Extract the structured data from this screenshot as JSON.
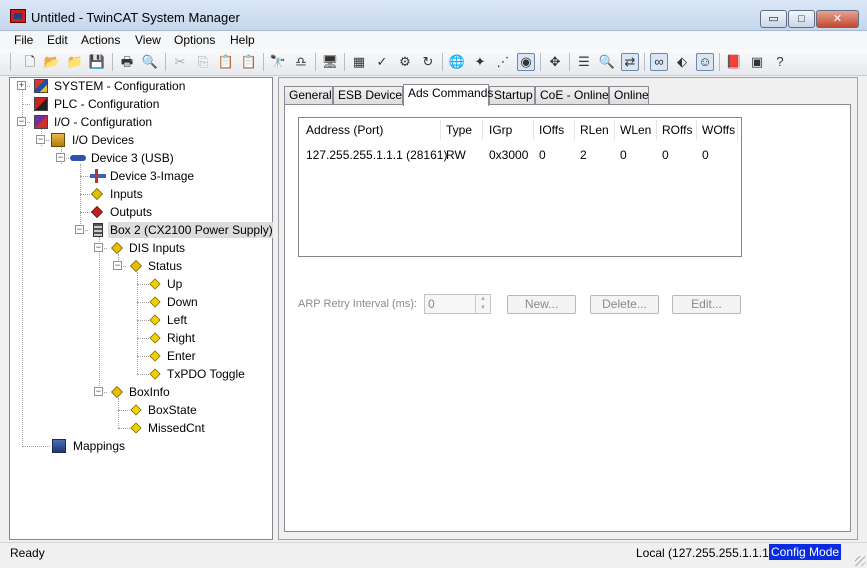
{
  "window": {
    "title": "Untitled - TwinCAT System Manager",
    "buttons": {
      "minimize": "▭",
      "maximize": "□",
      "close": "✕"
    }
  },
  "menu": [
    "File",
    "Edit",
    "Actions",
    "View",
    "Options",
    "Help"
  ],
  "toolbar": {
    "icons": [
      "new-icon",
      "open-icon",
      "open-folder-icon",
      "save-icon",
      "print-icon",
      "print-preview-icon",
      "cut-icon",
      "copy-icon",
      "paste-icon",
      "paste-with-links-icon",
      "find-icon",
      "find-next-icon",
      "target-system-icon",
      "generate-mappings-icon",
      "check-configuration-icon",
      "activate-configuration-icon",
      "restart-icon",
      "network-icon",
      "scan-icon",
      "start-free-run-icon",
      "toggle-online-icon",
      "append-icon",
      "show-variables-icon",
      "zoom-icon",
      "edit-mode-icon",
      "watch-icon",
      "connect-icon",
      "online-view-icon",
      "help-book-icon",
      "about-icon",
      "help-icon"
    ]
  },
  "tree": {
    "nodes": [
      {
        "label": "SYSTEM - Configuration",
        "icon": "system-icon"
      },
      {
        "label": "PLC - Configuration",
        "icon": "plc-icon"
      },
      {
        "label": "I/O - Configuration",
        "icon": "io-icon"
      },
      {
        "label": "I/O Devices",
        "icon": "devices-icon"
      },
      {
        "label": "Device 3 (USB)",
        "icon": "usb-device-icon"
      },
      {
        "label": "Device 3-Image",
        "icon": "process-image-icon"
      },
      {
        "label": "Inputs",
        "icon": "inputs-icon"
      },
      {
        "label": "Outputs",
        "icon": "outputs-icon"
      },
      {
        "label": "Box 2 (CX2100 Power Supply)",
        "icon": "box-icon"
      },
      {
        "label": "DIS Inputs",
        "icon": "inputs-icon"
      },
      {
        "label": "Status",
        "icon": "inputs-icon"
      },
      {
        "label": "Up",
        "icon": "variable-icon"
      },
      {
        "label": "Down",
        "icon": "variable-icon"
      },
      {
        "label": "Left",
        "icon": "variable-icon"
      },
      {
        "label": "Right",
        "icon": "variable-icon"
      },
      {
        "label": "Enter",
        "icon": "variable-icon"
      },
      {
        "label": "TxPDO Toggle",
        "icon": "variable-icon"
      },
      {
        "label": "BoxInfo",
        "icon": "inputs-icon"
      },
      {
        "label": "BoxState",
        "icon": "variable-icon"
      },
      {
        "label": "MissedCnt",
        "icon": "variable-icon"
      },
      {
        "label": "Mappings",
        "icon": "mappings-icon"
      }
    ]
  },
  "tabs": [
    "General",
    "ESB Device",
    "Ads Commands",
    "Startup",
    "CoE - Online",
    "Online"
  ],
  "active_tab": "Ads Commands",
  "ads_table": {
    "columns": [
      "Address (Port)",
      "Type",
      "IGrp",
      "IOffs",
      "RLen",
      "WLen",
      "ROffs",
      "WOffs"
    ],
    "rows": [
      [
        "127.255.255.1.1.1 (28161)",
        "RW",
        "0x3000",
        "0",
        "2",
        "0",
        "0",
        "0"
      ]
    ]
  },
  "arp": {
    "label": "ARP Retry Interval (ms):",
    "value": "0",
    "buttons": [
      "New...",
      "Delete...",
      "Edit..."
    ]
  },
  "status": {
    "left": "Ready",
    "address": "Local (127.255.255.1.1.1)",
    "mode": "Config Mode",
    "mode_color": "#0a2ce0"
  }
}
